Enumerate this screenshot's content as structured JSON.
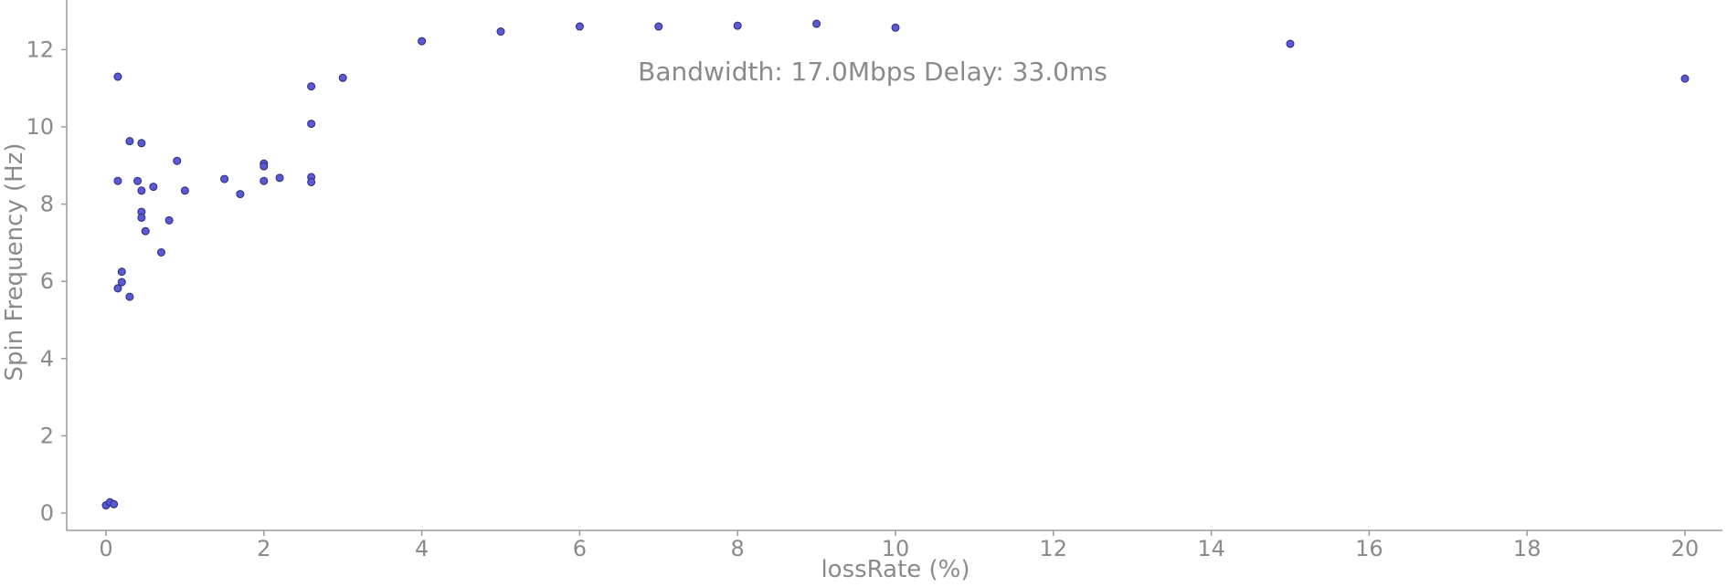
{
  "chart_data": {
    "type": "scatter",
    "title": "",
    "xlabel": "lossRate (%)",
    "ylabel": "Spin Frequency (Hz)",
    "annotation": "Bandwidth: 17.0Mbps Delay: 33.0ms",
    "xlim": [
      -0.5,
      20.5
    ],
    "ylim": [
      -0.45,
      13.3
    ],
    "xticks": [
      0,
      2,
      4,
      6,
      8,
      10,
      12,
      14,
      16,
      18,
      20
    ],
    "yticks": [
      0,
      2,
      4,
      6,
      8,
      10,
      12
    ],
    "grid": false,
    "legend": "none",
    "point_color": "#5a5ad6",
    "point_edge_color": "#2a2a7a",
    "axis_color": "#9a9a9a",
    "text_color": "#8a8a8a",
    "series": [
      {
        "x": [
          0.0,
          0.05,
          0.1,
          0.15,
          0.15,
          0.15,
          0.2,
          0.2,
          0.3,
          0.3,
          0.4,
          0.45,
          0.45,
          0.45,
          0.45,
          0.5,
          0.6,
          0.7,
          0.8,
          0.9,
          1.0,
          1.5,
          1.7,
          2.0,
          2.0,
          2.0,
          2.2,
          2.6,
          2.6,
          2.6,
          2.6,
          3.0,
          4.0,
          5.0,
          6.0,
          7.0,
          8.0,
          9.0,
          10.0,
          15.0,
          20.0
        ],
        "y": [
          0.2,
          0.28,
          0.23,
          11.3,
          8.6,
          5.82,
          6.25,
          5.98,
          9.63,
          5.6,
          8.6,
          9.58,
          8.35,
          7.8,
          7.65,
          7.3,
          8.45,
          6.75,
          7.58,
          9.12,
          8.35,
          8.65,
          8.26,
          9.05,
          8.98,
          8.6,
          8.68,
          11.05,
          10.08,
          8.7,
          8.57,
          11.27,
          12.22,
          12.47,
          12.6,
          12.6,
          12.62,
          12.67,
          12.57,
          12.15,
          11.25
        ]
      }
    ]
  }
}
